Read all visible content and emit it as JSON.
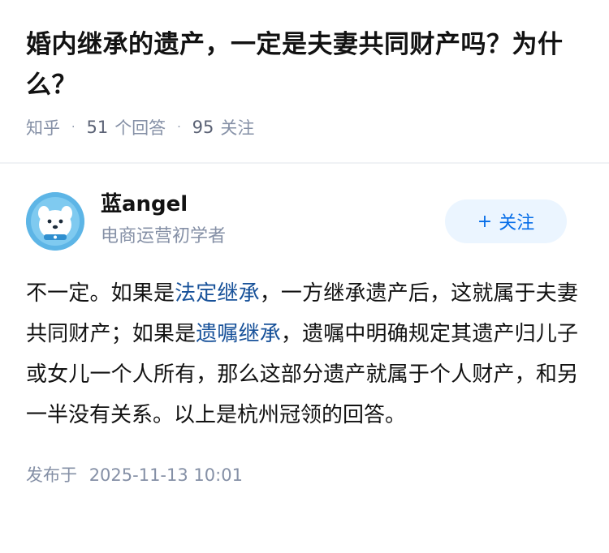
{
  "question": {
    "title": "婚内继承的遗产，一定是夫妻共同财产吗？为什么？",
    "source": "知乎",
    "answer_count": "51",
    "answer_label": "个回答",
    "follower_count": "95",
    "follower_label": "关注",
    "separator": "·"
  },
  "author": {
    "name": "蓝angel",
    "bio": "电商运营初学者",
    "avatar_icon": "avatar-cartoon-dog-icon",
    "follow_plus": "+",
    "follow_label": "关注"
  },
  "answer": {
    "segments": [
      {
        "text": "不一定。如果是",
        "link": false
      },
      {
        "text": "法定继承",
        "link": true
      },
      {
        "text": "，一方继承遗产后，这就属于夫妻共同财产；如果是",
        "link": false
      },
      {
        "text": "遗嘱继承",
        "link": true
      },
      {
        "text": "，遗嘱中明确规定其遗产归儿子或女儿一个人所有，那么这部分遗产就属于个人财产，和另一半没有关系。以上是杭州冠领的回答。",
        "link": false
      }
    ],
    "publish_label": "发布于",
    "publish_time": "2025-11-13 10:01"
  },
  "colors": {
    "link": "#175199",
    "accent": "#056de8",
    "follow_bg": "#ebf5ff",
    "muted": "#8590a6"
  }
}
